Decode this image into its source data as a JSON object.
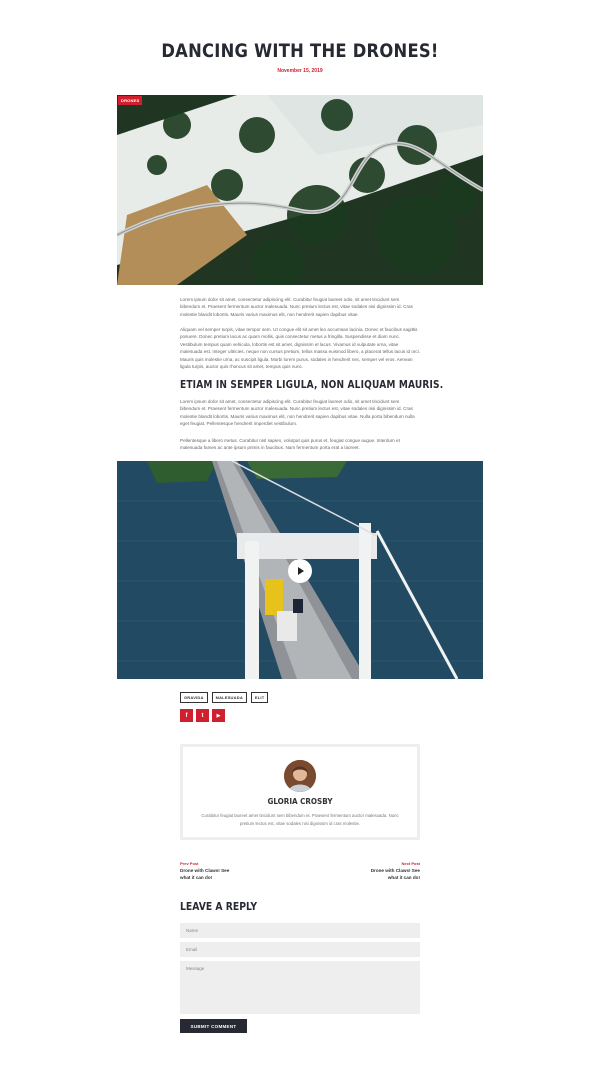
{
  "post": {
    "title": "DANCING WITH THE DRONES!",
    "date": "November 15, 2019",
    "category_badge": "DRONES"
  },
  "content": {
    "paragraphs": [
      "Lorem ipsum dolor sit amet, consectetur adipiscing elit. Curabitur feugiat laoreet odio, sit amet tincidunt sem bibendum et. Praesent fermentum auctor malesuada. Nunc pretium lectus est, vitae sodales nisi dignissim id. Cras molestie blandit lobortis. Mauris varius maximus elit, non hendrerit sapien dapibus vitae.",
      "Aliquam vel semper turpis, vitae tempor sem. Ut congue elit sit amet leo accumsan lacinia. Donec et faucibus sagittis posuere. Donec pretium lacus ac quam mollis, quis consectetur metus a fringilla. Suspendisse et diam nunc. Vestibulum tempus quam vehicula, lobortis est sit amet, dignissim et lacus. Vivamus id vulputate urna, vitae malesuada est. Integer ultricies, neque non cursus pretium, tellus massa euismod libero, a placerat tellus lacus id orci. Mauris quis molestie urna, ac suscipit ligula. Morbi lorem purus, sodales in hendrerit nec, semper vel eros. Aenean ligula turpis, auctor quis rhoncus sit amet, tempus quis nunc.",
      "Lorem ipsum dolor sit amet, consectetur adipiscing elit. Curabitur feugiat laoreet odio, sit amet tincidunt sem bibendum et. Praesent fermentum auctor malesuada. Nunc pretium lectus est, vitae sodales nisi dignissim id. Cras molestie blandit lobortis. Mauris varius maximus elit, non hendrerit sapien dapibus vitae. Nulla porta bibendum nulla eget feugiat. Pellentesque hendrerit imperdiet vestibulum.",
      "Pellentesque a libero metus. Curabitur nisl sapien, volutpat quis purus et, feugiat congue augue. Interdum et malesuada fames ac ante ipsum primis in faucibus. Nam fermentum porta erat a laoreet."
    ],
    "subheading": "ETIAM IN SEMPER LIGULA, NON ALIQUAM MAURIS."
  },
  "tags": [
    "GRAVIDA",
    "MALESUADA",
    "ELIT"
  ],
  "social": [
    {
      "icon": "facebook-icon",
      "glyph": "f"
    },
    {
      "icon": "twitter-icon",
      "glyph": "t"
    },
    {
      "icon": "youtube-icon",
      "glyph": "▶"
    }
  ],
  "author": {
    "name": "GLORIA CROSBY",
    "bio": "Curabitur feugiat laoreet amet tincidunt sem bibendum et. Praesent fermentum auctor malesuada. Nunc pretium lectus est, vitae sodales nisi dignissim id cras molestie."
  },
  "post_nav": {
    "prev_label": "Prev Post",
    "prev_title": "Drone with Claws! See what it can do!",
    "next_label": "Next Post",
    "next_title": "Drone with Claws! See what it can do!"
  },
  "reply": {
    "heading": "LEAVE A REPLY",
    "name_placeholder": "Name",
    "email_placeholder": "Email",
    "message_placeholder": "Message",
    "submit_label": "SUBMIT COMMENT"
  },
  "colors": {
    "accent": "#d0202e",
    "dark": "#272a33",
    "field_bg": "#eeeeee"
  }
}
